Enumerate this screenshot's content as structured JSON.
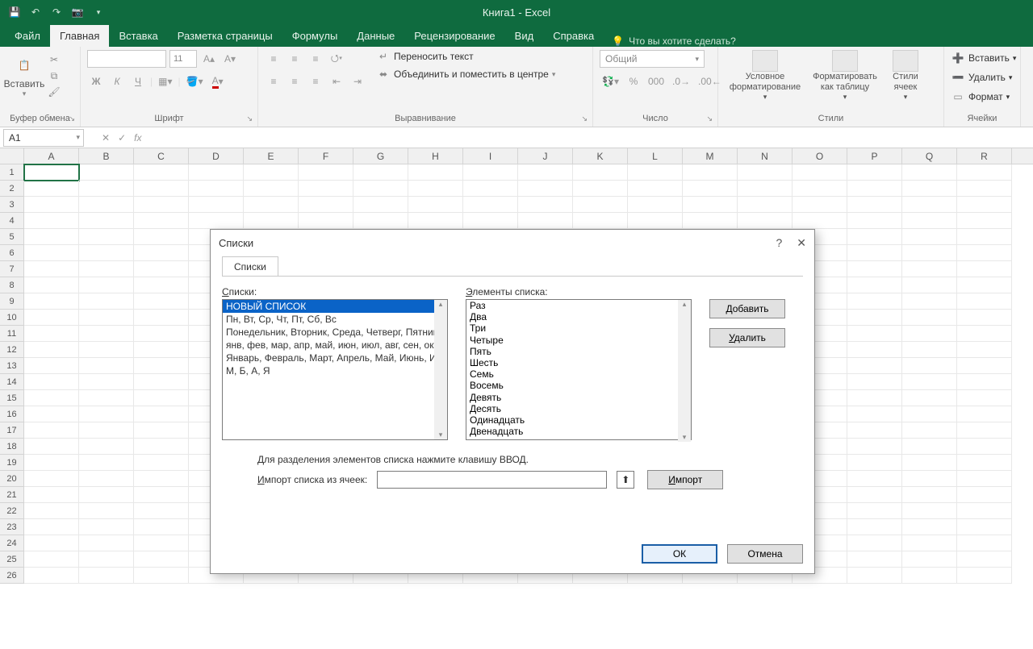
{
  "title": "Книга1  -  Excel",
  "qat_icons": [
    "save-icon",
    "undo-icon",
    "redo-icon",
    "camera-icon"
  ],
  "tabs": [
    "Файл",
    "Главная",
    "Вставка",
    "Разметка страницы",
    "Формулы",
    "Данные",
    "Рецензирование",
    "Вид",
    "Справка"
  ],
  "active_tab_index": 1,
  "tellme": "Что вы хотите сделать?",
  "ribbon": {
    "clipboard": {
      "paste": "Вставить",
      "group": "Буфер обмена"
    },
    "font": {
      "size": "11",
      "group": "Шрифт",
      "bold": "Ж",
      "italic": "К",
      "underline": "Ч"
    },
    "alignment": {
      "wrap": "Переносить текст",
      "merge": "Объединить и поместить в центре",
      "group": "Выравнивание"
    },
    "number": {
      "format": "Общий",
      "group": "Число"
    },
    "styles": {
      "cond": "Условное форматирование",
      "table": "Форматировать как таблицу",
      "cell": "Стили ячеек",
      "group": "Стили"
    },
    "cells": {
      "insert": "Вставить",
      "delete": "Удалить",
      "format": "Формат",
      "group": "Ячейки"
    }
  },
  "namebox": "A1",
  "columns": [
    "A",
    "B",
    "C",
    "D",
    "E",
    "F",
    "G",
    "H",
    "I",
    "J",
    "K",
    "L",
    "M",
    "N",
    "O",
    "P",
    "Q",
    "R"
  ],
  "row_count": 26,
  "dialog": {
    "title": "Списки",
    "tab": "Списки",
    "list_label": "Списки:",
    "elements_label": "Элементы списка:",
    "lists": [
      "НОВЫЙ СПИСОК",
      "Пн, Вт, Ср, Чт, Пт, Сб, Вс",
      "Понедельник, Вторник, Среда, Четверг, Пятница, Суббота, Воскресенье",
      "янв, фев, мар, апр, май, июн, июл, авг, сен, окт, ноя, дек",
      "Январь, Февраль, Март, Апрель, Май, Июнь, Июль, Август, Сентябрь",
      "М, Б, А, Я"
    ],
    "selected_list_index": 0,
    "elements": [
      "Раз",
      "Два",
      "Три",
      "Четыре",
      "Пять",
      "Шесть",
      "Семь",
      "Восемь",
      "Девять",
      "Десять",
      "Одинадцать",
      "Двенадцать"
    ],
    "add": "Добавить",
    "delete": "Удалить",
    "hint": "Для разделения элементов списка нажмите клавишу ВВОД.",
    "import_label": "Импорт списка из ячеек:",
    "import_btn": "Импорт",
    "ok": "ОК",
    "cancel": "Отмена"
  }
}
